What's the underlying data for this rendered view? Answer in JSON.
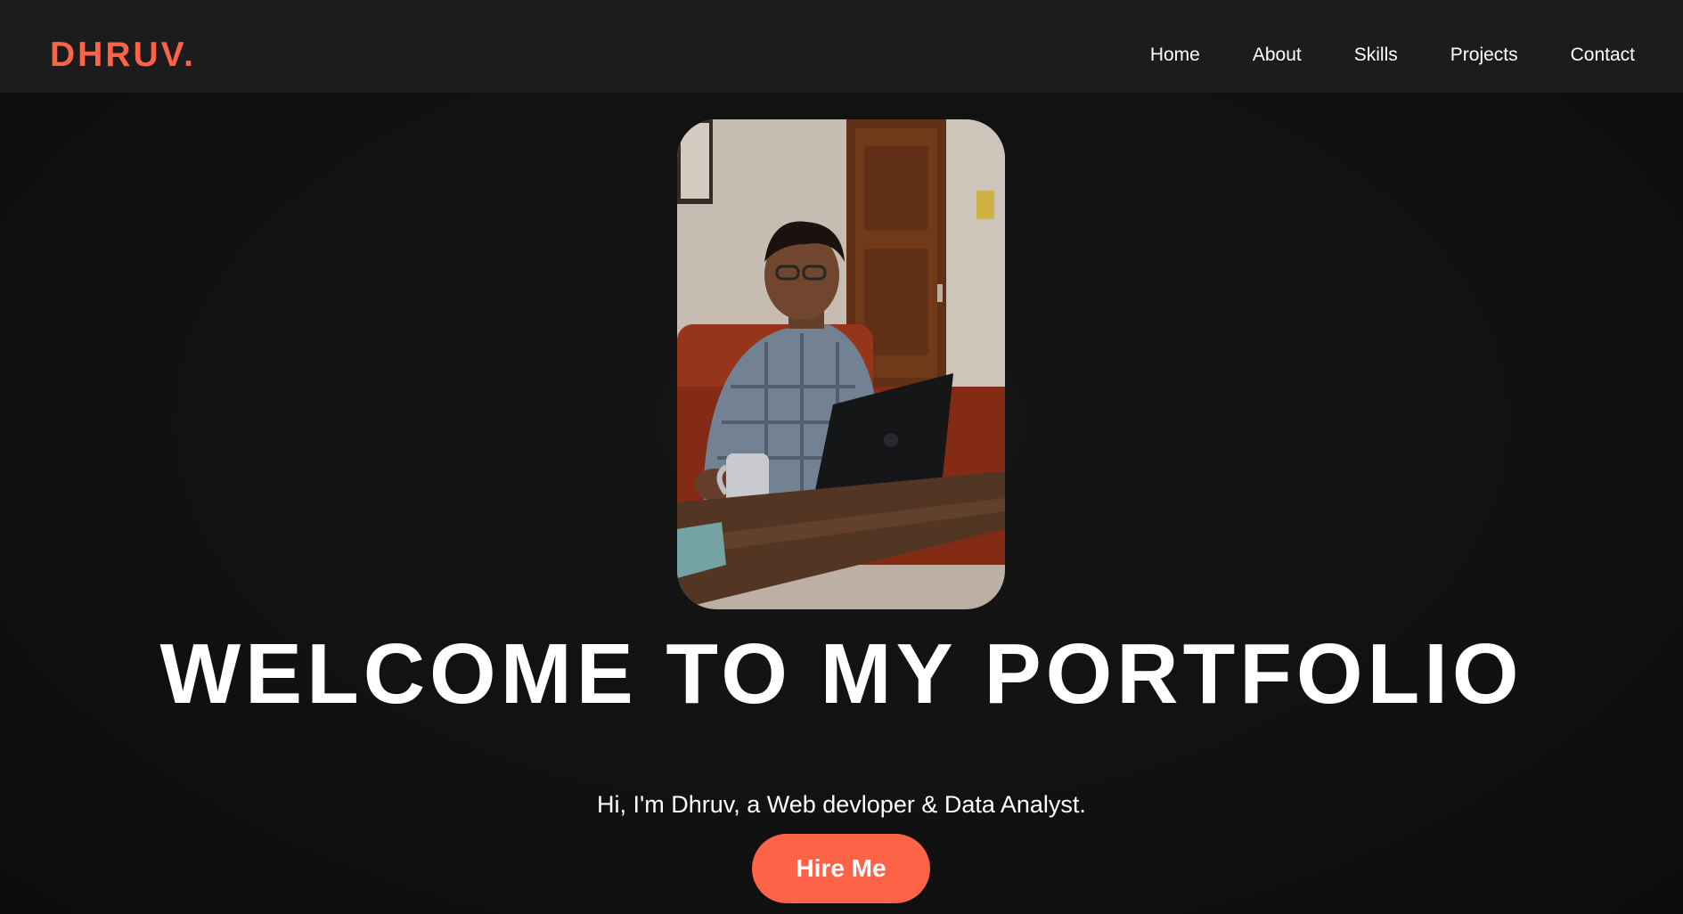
{
  "nav": {
    "logo": "DHRUV.",
    "links": [
      "Home",
      "About",
      "Skills",
      "Projects",
      "Contact"
    ]
  },
  "hero": {
    "title": "WELCOME TO MY PORTFOLIO",
    "subtitle": "Hi, I'm Dhruv, a Web devloper & Data Analyst.",
    "cta_label": "Hire Me",
    "photo_name": "profile-photo"
  },
  "colors": {
    "accent": "#ff6347",
    "nav_background": "#1c1c1c",
    "page_background": "#111111",
    "text": "#ffffff"
  }
}
